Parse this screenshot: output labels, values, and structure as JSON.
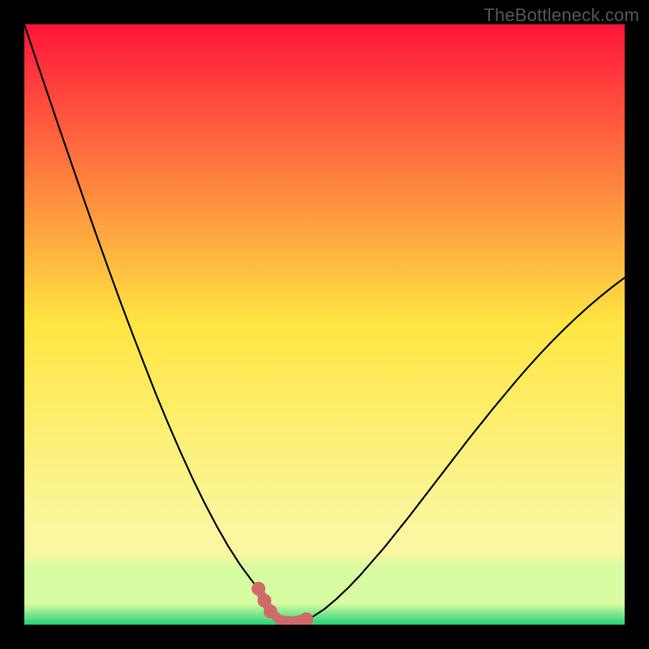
{
  "watermark": "TheBottleneck.com",
  "colors": {
    "frame": "#000000",
    "curve": "#000000",
    "marker_fill": "#cf6a6b",
    "marker_stroke": "#cf6a6b",
    "grad_top": "#ff153b",
    "grad_mid": "#ffe642",
    "grad_low": "#fbf7a0",
    "grad_band": "#d8fca2",
    "grad_bottom": "#22d276"
  },
  "chart_data": {
    "type": "line",
    "title": "",
    "xlabel": "",
    "ylabel": "",
    "xlim": [
      0,
      100
    ],
    "ylim": [
      0,
      100
    ],
    "x": [
      0,
      2,
      4,
      6,
      8,
      10,
      12,
      14,
      16,
      18,
      20,
      22,
      24,
      26,
      28,
      30,
      32,
      34,
      36,
      38,
      39,
      40,
      41,
      42,
      43,
      44,
      45,
      46,
      48,
      50,
      52,
      54,
      56,
      58,
      60,
      62,
      64,
      66,
      68,
      70,
      72,
      74,
      76,
      78,
      80,
      82,
      84,
      86,
      88,
      90,
      92,
      94,
      96,
      98,
      100
    ],
    "values": [
      100,
      94.0,
      88.1,
      82.2,
      76.4,
      70.6,
      64.9,
      59.3,
      53.8,
      48.5,
      43.3,
      38.2,
      33.4,
      28.8,
      24.4,
      20.3,
      16.5,
      13.0,
      9.9,
      7.2,
      6.0,
      4.0,
      2.2,
      1.0,
      0.4,
      0.3,
      0.3,
      0.5,
      1.3,
      2.6,
      4.3,
      6.2,
      8.3,
      10.6,
      12.9,
      15.4,
      17.9,
      20.5,
      23.1,
      25.7,
      28.3,
      30.9,
      33.4,
      35.9,
      38.3,
      40.7,
      43.0,
      45.2,
      47.3,
      49.3,
      51.2,
      53.0,
      54.7,
      56.3,
      57.8
    ],
    "markers_x": [
      39,
      40,
      41,
      43,
      44,
      45,
      46,
      47
    ],
    "markers_y": [
      6.0,
      4.0,
      2.2,
      0.4,
      0.3,
      0.3,
      0.5,
      0.9
    ],
    "gradient_stops": [
      {
        "offset": 0.0,
        "key": "grad_top"
      },
      {
        "offset": 0.5,
        "key": "grad_mid"
      },
      {
        "offset": 0.84,
        "key": "grad_low"
      },
      {
        "offset": 0.88,
        "key": "grad_low"
      },
      {
        "offset": 0.905,
        "key": "grad_band"
      },
      {
        "offset": 0.965,
        "key": "grad_band"
      },
      {
        "offset": 1.0,
        "key": "grad_bottom"
      }
    ]
  }
}
